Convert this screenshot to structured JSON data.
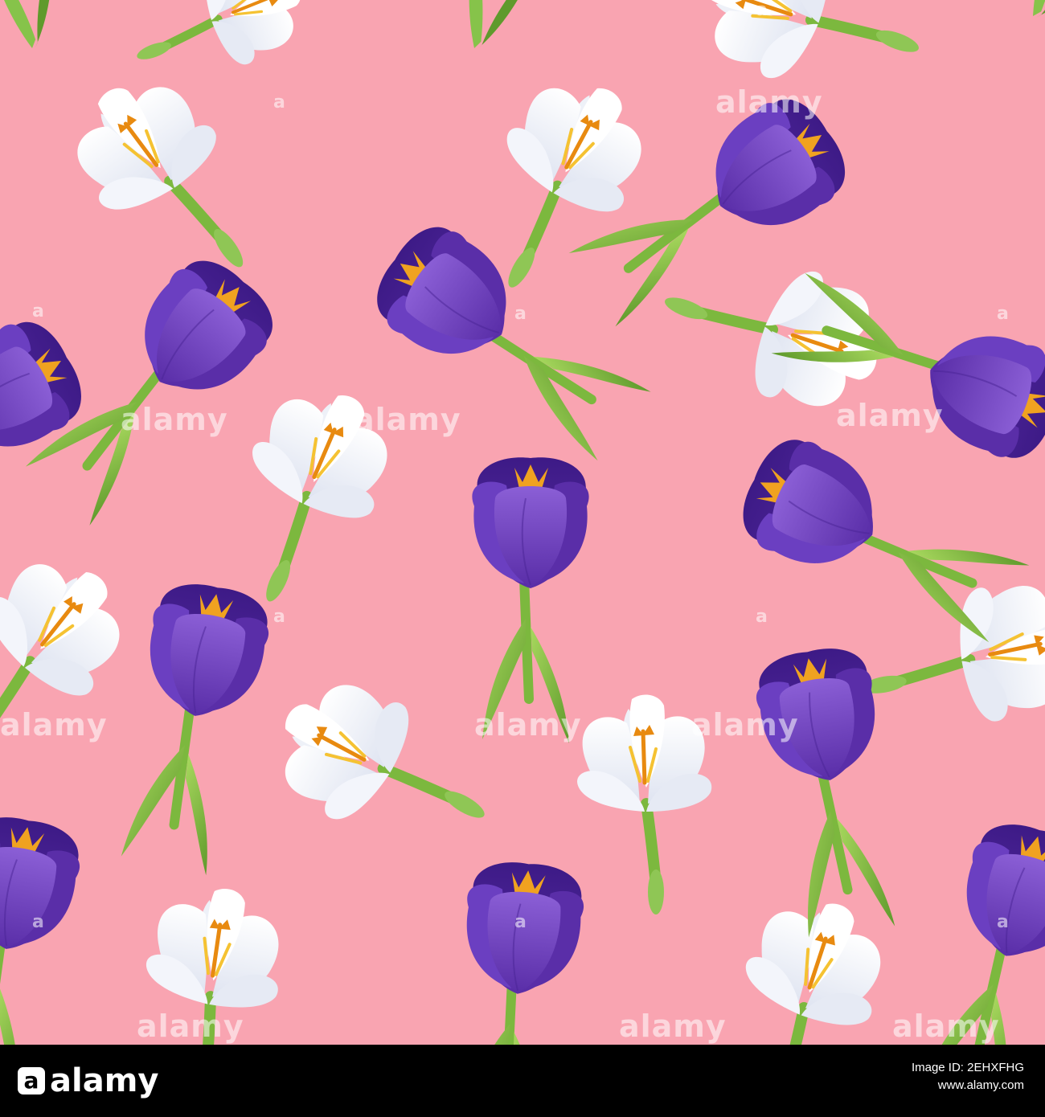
{
  "colors": {
    "background": "#f9a4b1",
    "purple_dark": "#4a2495",
    "purple_mid": "#6b3fc1",
    "purple_light": "#8b5fd6",
    "white_petal": "#ffffff",
    "white_shade": "#e3e7f2",
    "stamen": "#f0a220",
    "leaf": "#86c34a",
    "leaf_dark": "#5f9a2c",
    "footer": "#000000"
  },
  "flowers": [
    {
      "kind": "white-crocus",
      "icon": "white-crocus-flower"
    },
    {
      "kind": "purple-crocus",
      "icon": "purple-crocus-flower"
    }
  ],
  "watermark": {
    "text": "alamy",
    "mark": "a"
  },
  "footer": {
    "logo": "alamy",
    "image_id_line": "Image ID: 2EHXFHG",
    "site": "www.alamy.com"
  }
}
